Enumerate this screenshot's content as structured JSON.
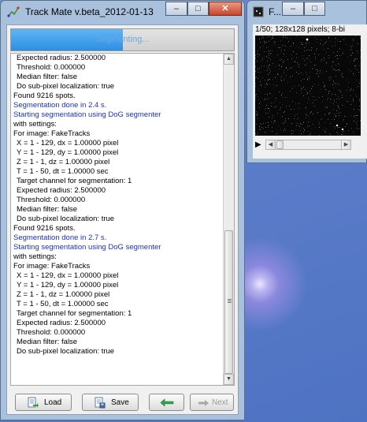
{
  "main_window": {
    "title": "Track Mate v.beta_2012-01-13",
    "controls": {
      "minimize": "–",
      "maximize": "□",
      "close": "✕"
    },
    "progress": {
      "text": "Segmenting...",
      "fraction": 0.5
    },
    "log": [
      {
        "text": "Expected radius: 2.500000",
        "style": "ind"
      },
      {
        "text": "Threshold: 0.000000",
        "style": "ind"
      },
      {
        "text": "Median filter: false",
        "style": "ind"
      },
      {
        "text": "Do sub-pixel localization: true",
        "style": "ind"
      },
      {
        "text": "Found 9216 spots.",
        "style": ""
      },
      {
        "text": "Segmentation done in 2.4 s.",
        "style": "blue"
      },
      {
        "text": "Starting segmentation using DoG segmenter",
        "style": "blue"
      },
      {
        "text": "with settings:",
        "style": ""
      },
      {
        "text": "For image: FakeTracks",
        "style": ""
      },
      {
        "text": "X =      1 -  129, dx = 1.00000 pixel",
        "style": "ind"
      },
      {
        "text": "Y =      1 -  129, dy = 1.00000 pixel",
        "style": "ind"
      },
      {
        "text": "Z =      1 -     1, dz = 1.00000 pixel",
        "style": "ind"
      },
      {
        "text": "T =      1 -    50, dt = 1.00000 sec",
        "style": "ind"
      },
      {
        "text": "Target channel for segmentation: 1",
        "style": "ind"
      },
      {
        "text": "Expected radius: 2.500000",
        "style": "ind"
      },
      {
        "text": "Threshold: 0.000000",
        "style": "ind"
      },
      {
        "text": "Median filter: false",
        "style": "ind"
      },
      {
        "text": "Do sub-pixel localization: true",
        "style": "ind"
      },
      {
        "text": "Found 9216 spots.",
        "style": ""
      },
      {
        "text": "Segmentation done in 2.7 s.",
        "style": "blue"
      },
      {
        "text": "Starting segmentation using DoG segmenter",
        "style": "blue"
      },
      {
        "text": "with settings:",
        "style": ""
      },
      {
        "text": "For image: FakeTracks",
        "style": ""
      },
      {
        "text": "X =      1 -  129, dx = 1.00000 pixel",
        "style": "ind"
      },
      {
        "text": "Y =      1 -  129, dy = 1.00000 pixel",
        "style": "ind"
      },
      {
        "text": "Z =      1 -     1, dz = 1.00000 pixel",
        "style": "ind"
      },
      {
        "text": "T =      1 -    50, dt = 1.00000 sec",
        "style": "ind"
      },
      {
        "text": "Target channel for segmentation: 1",
        "style": "ind"
      },
      {
        "text": "Expected radius: 2.500000",
        "style": "ind"
      },
      {
        "text": "Threshold: 0.000000",
        "style": "ind"
      },
      {
        "text": "Median filter: false",
        "style": "ind"
      },
      {
        "text": "Do sub-pixel localization: true",
        "style": "ind"
      }
    ],
    "buttons": {
      "load": "Load",
      "save": "Save",
      "back_icon": "green-left-arrow-icon",
      "next": "Next"
    }
  },
  "image_window": {
    "title": "F...",
    "info": "1/50; 128x128 pixels; 8-bi",
    "controls": {
      "minimize": "–",
      "maximize": "□"
    },
    "play_icon": "▶"
  },
  "colors": {
    "accent_blue": "#1b2fd1",
    "progress": "#2e8fe2",
    "next_arrow_green": "#2ea64a"
  }
}
